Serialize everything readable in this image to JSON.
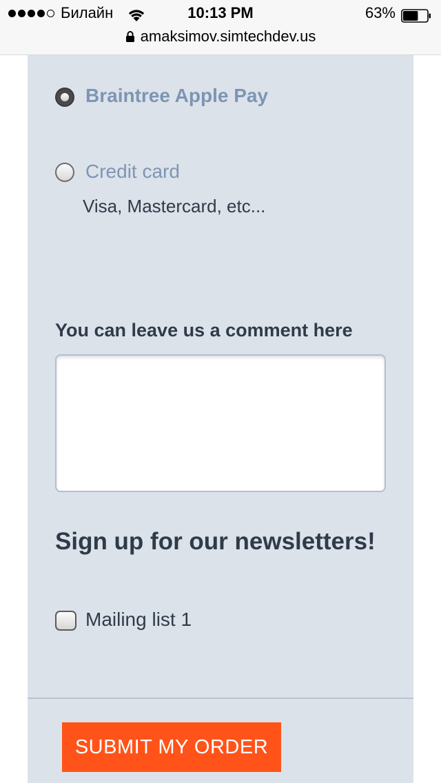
{
  "status_bar": {
    "carrier": "Билайн",
    "time": "10:13 PM",
    "battery_percent": "63%",
    "battery_level": 0.63,
    "signal_bars_filled": 4,
    "signal_bars_total": 5,
    "url": "amaksimov.simtechdev.us"
  },
  "payment": {
    "options": [
      {
        "label": "Braintree Apple Pay",
        "selected": true
      },
      {
        "label": "Credit card",
        "description": "Visa, Mastercard, etc...",
        "selected": false
      }
    ]
  },
  "comment": {
    "label": "You can leave us a comment here",
    "value": "",
    "placeholder": ""
  },
  "newsletter": {
    "title": "Sign up for our newsletters!",
    "lists": [
      {
        "label": "Mailing list 1",
        "checked": false
      }
    ]
  },
  "actions": {
    "submit_label": "SUBMIT MY ORDER"
  },
  "colors": {
    "panel_bg": "#dce2ea",
    "accent": "#ff5319",
    "option_label": "#7d95b4",
    "text_dark": "#2f3b48"
  },
  "icons": {
    "lock": "lock-icon",
    "wifi": "wifi-icon",
    "battery": "battery-icon"
  }
}
